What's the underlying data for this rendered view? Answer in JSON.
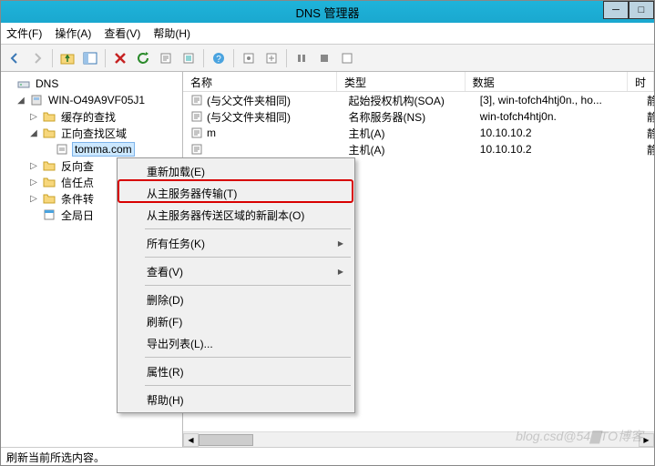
{
  "window": {
    "title": "DNS 管理器"
  },
  "menubar": {
    "file": "文件(F)",
    "action": "操作(A)",
    "view": "查看(V)",
    "help": "帮助(H)"
  },
  "tree": {
    "root": "DNS",
    "server": "WIN-O49A9VF05J1",
    "cache": "缓存的查找",
    "fwd": "正向查找区域",
    "zone": "tomma.com",
    "rev_prefix": "反向查",
    "trust_prefix": "信任点",
    "cond_prefix": "条件转",
    "log_prefix": "全局日"
  },
  "list": {
    "headers": {
      "name": "名称",
      "type": "类型",
      "data": "数据",
      "time": "时"
    },
    "rows": [
      {
        "name": "(与父文件夹相同)",
        "type": "起始授权机构(SOA)",
        "data": "[3], win-tofch4htj0n., ho...",
        "time": "静态"
      },
      {
        "name": "(与父文件夹相同)",
        "type": "名称服务器(NS)",
        "data": "win-tofch4htj0n.",
        "time": "静态"
      },
      {
        "name": "m",
        "type": "主机(A)",
        "data": "10.10.10.2",
        "time": "静态"
      },
      {
        "name": "",
        "type": "主机(A)",
        "data": "10.10.10.2",
        "time": "静态"
      }
    ]
  },
  "context_menu": {
    "reload": "重新加载(E)",
    "transfer": "从主服务器传输(T)",
    "new_copy": "从主服务器传送区域的新副本(O)",
    "all_tasks": "所有任务(K)",
    "view": "查看(V)",
    "delete": "删除(D)",
    "refresh": "刷新(F)",
    "export": "导出列表(L)...",
    "properties": "属性(R)",
    "help": "帮助(H)"
  },
  "status": {
    "text": "刷新当前所选内容。"
  },
  "watermark": "blog.csd@54▇TO博客"
}
